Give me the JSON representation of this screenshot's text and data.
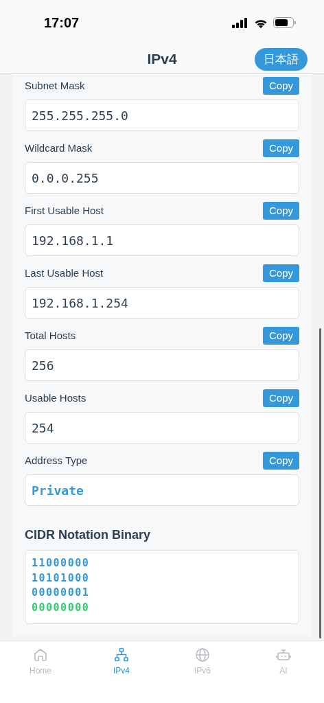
{
  "status_bar": {
    "time": "17:07"
  },
  "header": {
    "title": "IPv4",
    "language_button": "日本語"
  },
  "fields": [
    {
      "label": "Subnet Mask",
      "copy": "Copy",
      "value": "255.255.255.0",
      "kind": "plain"
    },
    {
      "label": "Wildcard Mask",
      "copy": "Copy",
      "value": "0.0.0.255",
      "kind": "plain"
    },
    {
      "label": "First Usable Host",
      "copy": "Copy",
      "value": "192.168.1.1",
      "kind": "plain"
    },
    {
      "label": "Last Usable Host",
      "copy": "Copy",
      "value": "192.168.1.254",
      "kind": "plain"
    },
    {
      "label": "Total Hosts",
      "copy": "Copy",
      "value": "256",
      "kind": "plain"
    },
    {
      "label": "Usable Hosts",
      "copy": "Copy",
      "value": "254",
      "kind": "plain"
    },
    {
      "label": "Address Type",
      "copy": "Copy",
      "value": "Private",
      "kind": "highlight"
    }
  ],
  "cidr_binary": {
    "title": "CIDR Notation Binary",
    "rows": [
      {
        "bits": "11000000",
        "kind": "network"
      },
      {
        "bits": "10101000",
        "kind": "network"
      },
      {
        "bits": "00000001",
        "kind": "network"
      },
      {
        "bits": "00000000",
        "kind": "host"
      }
    ]
  },
  "tabs": [
    {
      "label": "Home",
      "kind": "home",
      "selected": false
    },
    {
      "label": "IPv4",
      "kind": "network",
      "selected": true
    },
    {
      "label": "IPv6",
      "kind": "globe",
      "selected": false
    },
    {
      "label": "AI",
      "kind": "robot",
      "selected": false
    }
  ]
}
